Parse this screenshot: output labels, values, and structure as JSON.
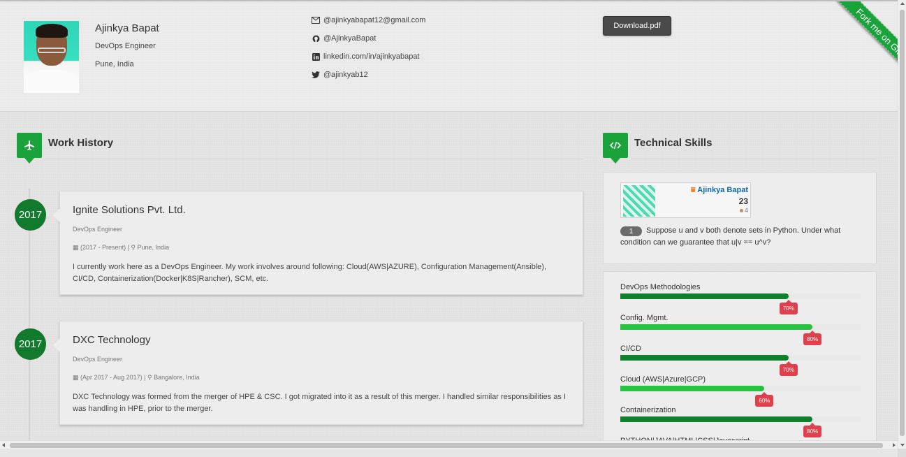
{
  "profile": {
    "name": "Ajinkya Bapat",
    "title": "DevOps Engineer",
    "location": "Pune, India"
  },
  "contacts": [
    {
      "icon": "envelope-icon",
      "text": "@ajinkyabapat12@gmail.com"
    },
    {
      "icon": "github-icon",
      "text": "@AjinkyaBapat"
    },
    {
      "icon": "linkedin-icon",
      "text": "linkedin.com/in/ajinkyabapat"
    },
    {
      "icon": "twitter-icon",
      "text": "@ajinkyab12"
    }
  ],
  "download_label": "Download.pdf",
  "ribbon_label": "Fork me on GitHub",
  "colors": {
    "accent": "#1aa33a",
    "year_badge": "#117a2d",
    "skill_dark": "#0f7f2c",
    "skill_light": "#27c23f",
    "tag": "#e0404c"
  },
  "work": {
    "heading": "Work History",
    "jobs": [
      {
        "year": "2017",
        "company": "Ignite Solutions Pvt. Ltd.",
        "role": "DevOps Engineer",
        "period": "(2017 - Present)",
        "location": "Pune, India",
        "description": "I currently work here as a DevOps Engineer. My work involves around following: Cloud(AWS|AZURE), Configuration Management(Ansible), CI/CD, Containerization(Docker|K8S|Rancher), SCM, etc."
      },
      {
        "year": "2017",
        "company": "DXC Technology",
        "role": "DevOps Engineer",
        "period": "(Apr 2017 - Aug 2017)",
        "location": "Bangalore, India",
        "description": "DXC Technology was formed from the merger of HPE & CSC. I got migrated into it as a result of this merger. I handled similar responsibilities as I was handling in HPE, prior to the merger."
      }
    ]
  },
  "skills_section": {
    "heading": "Technical Skills",
    "stackoverflow": {
      "name": "Ajinkya Bapat",
      "reputation": "23",
      "bronze": "4",
      "answer_count": "1",
      "question": "Suppose u and v both denote sets in Python. Under what condition can we guarantee that u|v == u^v?"
    },
    "skills": [
      {
        "label": "DevOps Methodologies",
        "value": 70,
        "tag": "70%",
        "shade": "dark"
      },
      {
        "label": "Config. Mgmt.",
        "value": 80,
        "tag": "80%",
        "shade": "light"
      },
      {
        "label": "CI/CD",
        "value": 70,
        "tag": "70%",
        "shade": "dark"
      },
      {
        "label": "Cloud (AWS|Azure|GCP)",
        "value": 60,
        "tag": "60%",
        "shade": "light"
      },
      {
        "label": "Containerization",
        "value": 80,
        "tag": "80%",
        "shade": "dark"
      },
      {
        "label": "PYTHON|JAVA|HTML|CSS|Javascript",
        "value": 60,
        "tag": "",
        "shade": "light"
      }
    ]
  }
}
